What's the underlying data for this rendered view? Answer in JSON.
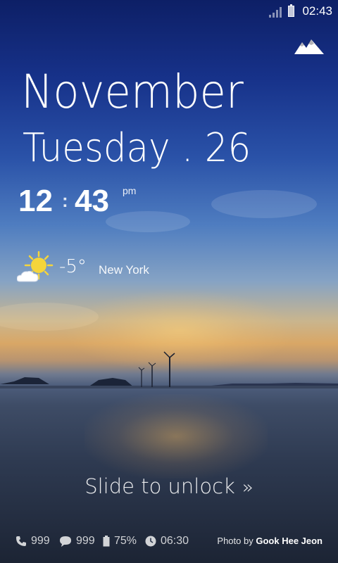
{
  "status_bar": {
    "time": "02:43",
    "signal_icon": "signal-icon",
    "battery_icon": "battery-icon"
  },
  "camera_icon": "mountain-icon",
  "date": {
    "month": "November",
    "day": "Tuesday . 26"
  },
  "clock": {
    "hours": "12",
    "separator": ":",
    "minutes": "43",
    "ampm": "pm"
  },
  "weather": {
    "icon": "sun-cloud-icon",
    "temperature": "-5°",
    "city": "New York"
  },
  "unlock": {
    "label": "Slide to unlock",
    "chevron": "»"
  },
  "notifications": {
    "calls": "999",
    "messages": "999",
    "battery": "75%",
    "alarm": "06:30"
  },
  "credit": {
    "prefix": "Photo by",
    "author": "Gook Hee Jeon"
  },
  "colors": {
    "sky_top": "#0d1f66",
    "horizon": "#d9a766",
    "water": "#2e3a51"
  }
}
